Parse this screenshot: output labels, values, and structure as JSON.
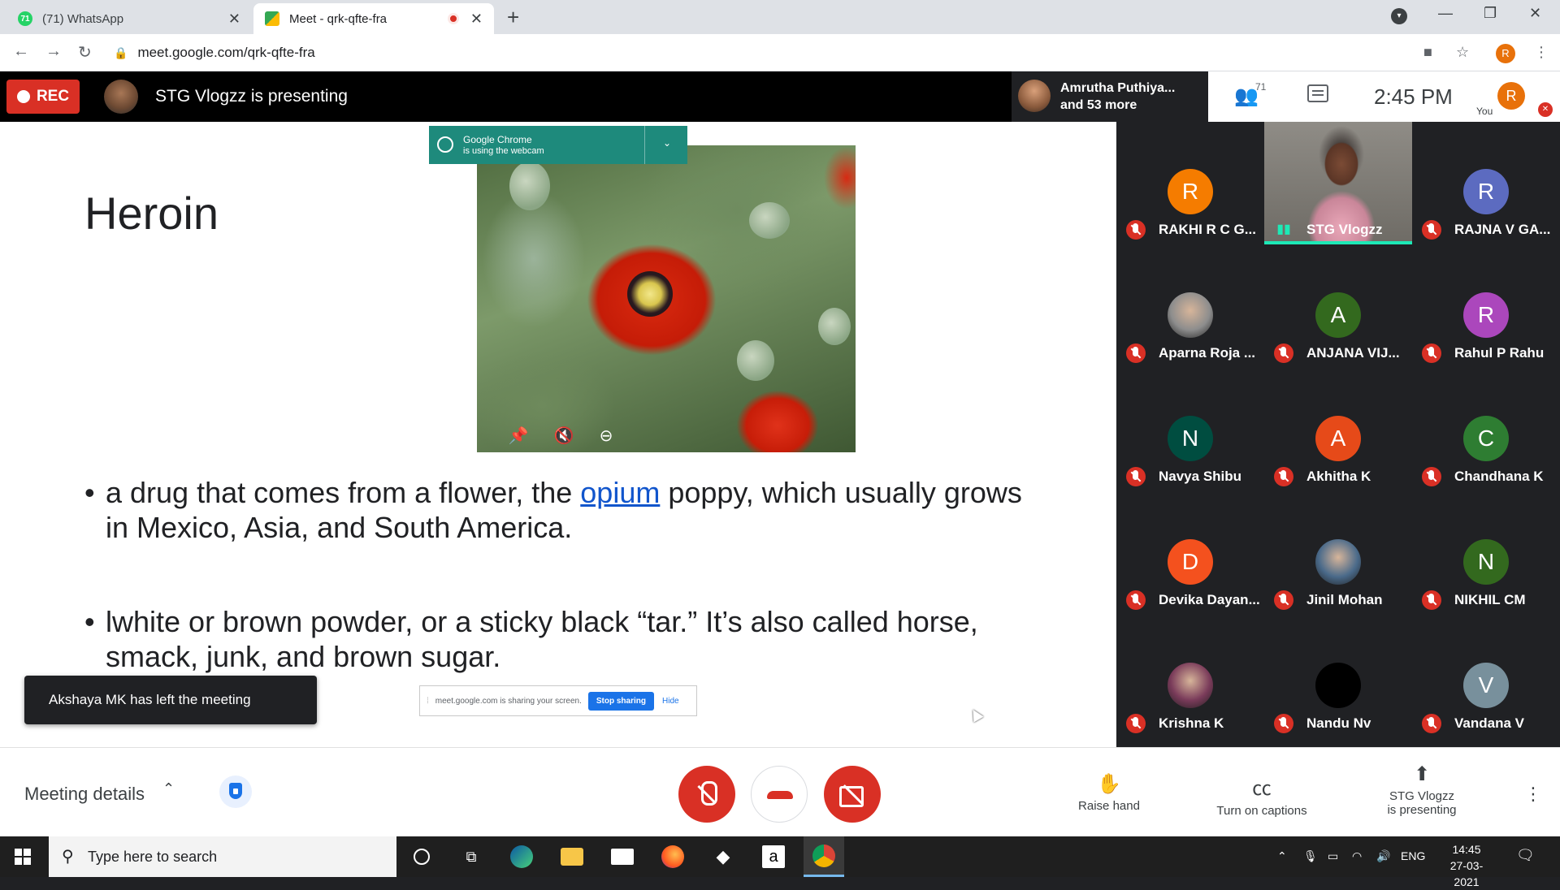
{
  "browser": {
    "tabs": [
      {
        "title": "(71) WhatsApp",
        "favicon": "whatsapp-icon",
        "badge": "71"
      },
      {
        "title": "Meet - qrk-qfte-fra",
        "favicon": "google-meet-icon"
      }
    ],
    "url": "meet.google.com/qrk-qfte-fra",
    "profile_initial": "R"
  },
  "meet_header": {
    "rec_label": "REC",
    "presenting_text": "STG Vlogzz is presenting",
    "featured_name_1": "Amrutha Puthiya...",
    "featured_name_2": "and 53 more",
    "people_count": "71",
    "time": "2:45 PM",
    "you_label": "You",
    "you_initial": "R"
  },
  "slide": {
    "title": "Heroin",
    "bullet1_pre": "a drug that comes from a flower, the ",
    "bullet1_link": "opium",
    "bullet1_post": " poppy, which usually grows in Mexico, Asia, and South America.",
    "bullet2": " lwhite or brown powder, or a sticky black “tar.” It’s also called horse, smack, junk, and brown sugar."
  },
  "webcam_notice": {
    "line1": "Google Chrome",
    "line2": "is using the webcam"
  },
  "toast": "Akshaya MK has left the meeting",
  "share_bar": {
    "text": "meet.google.com is sharing your screen.",
    "stop": "Stop sharing",
    "hide": "Hide"
  },
  "participants": [
    {
      "name": "RAKHI R C G...",
      "initial": "R",
      "color": "#f57c00",
      "muted": true
    },
    {
      "name": "STG Vlogzz",
      "initial": "",
      "color": "",
      "muted": false,
      "video": true
    },
    {
      "name": "RAJNA V GA...",
      "initial": "R",
      "color": "#5c6bc0",
      "muted": true
    },
    {
      "name": "Aparna Roja ...",
      "initial": "",
      "color": "#8d8d8d",
      "muted": true,
      "photo": true
    },
    {
      "name": "ANJANA VIJ...",
      "initial": "A",
      "color": "#33691e",
      "muted": true
    },
    {
      "name": "Rahul P Rahu",
      "initial": "R",
      "color": "#ab47bc",
      "muted": true
    },
    {
      "name": "Navya Shibu",
      "initial": "N",
      "color": "#004d40",
      "muted": true
    },
    {
      "name": "Akhitha K",
      "initial": "A",
      "color": "#e64a19",
      "muted": true
    },
    {
      "name": "Chandhana K",
      "initial": "C",
      "color": "#2e7d32",
      "muted": true
    },
    {
      "name": "Devika Dayan...",
      "initial": "D",
      "color": "#f4511e",
      "muted": true
    },
    {
      "name": "Jinil Mohan",
      "initial": "",
      "color": "#4a6a8a",
      "muted": true,
      "photo": true
    },
    {
      "name": "NIKHIL CM",
      "initial": "N",
      "color": "#33691e",
      "muted": true
    },
    {
      "name": "Krishna K",
      "initial": "",
      "color": "#7a3b5a",
      "muted": true,
      "photo": true
    },
    {
      "name": "Nandu Nv",
      "initial": "",
      "color": "#000000",
      "muted": true
    },
    {
      "name": "Vandana V",
      "initial": "V",
      "color": "#78909c",
      "muted": true
    }
  ],
  "controls": {
    "meeting_details": "Meeting details",
    "raise_hand": "Raise hand",
    "captions": "Turn on captions",
    "presenting_1": "STG Vlogzz",
    "presenting_2": "is presenting"
  },
  "taskbar": {
    "search_placeholder": "Type here to search",
    "lang": "ENG",
    "time": "14:45",
    "date": "27-03-2021"
  }
}
